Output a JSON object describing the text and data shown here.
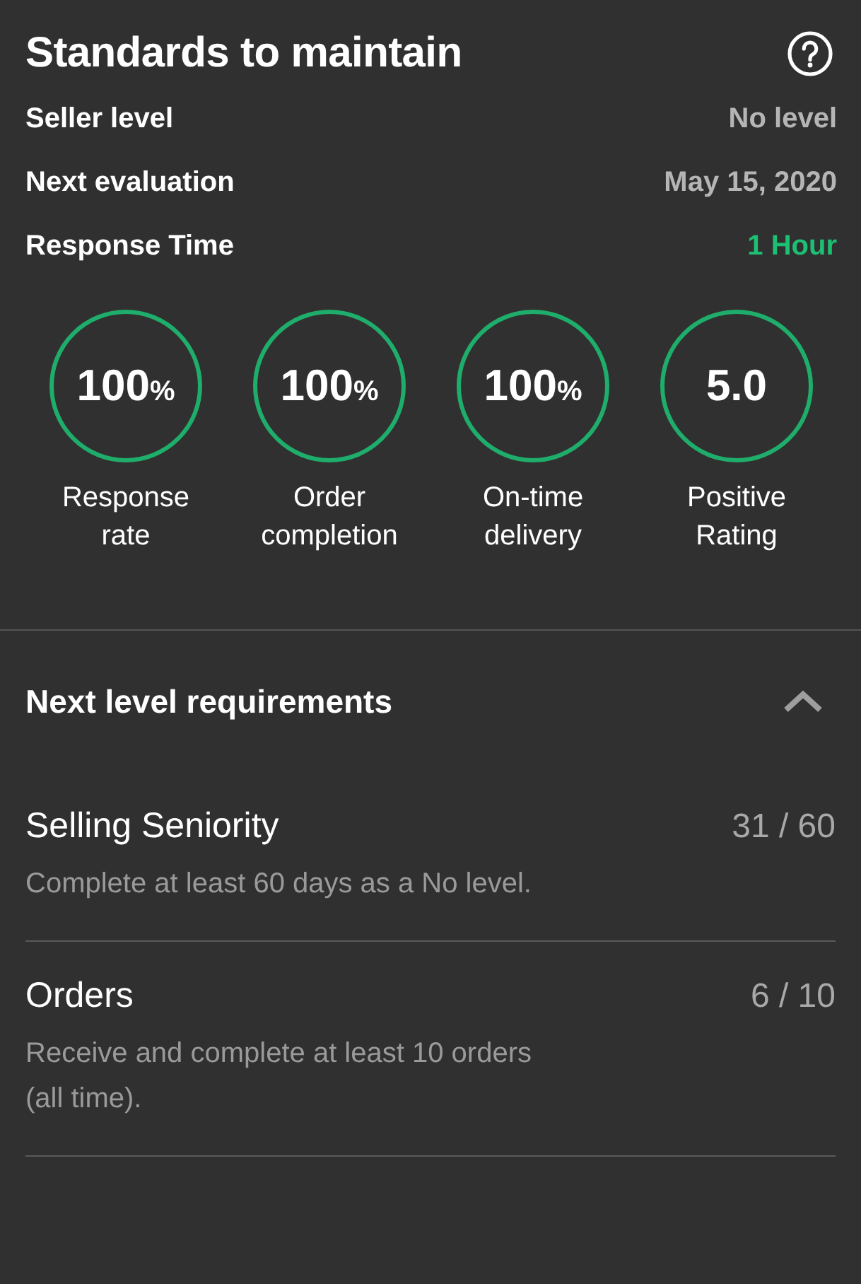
{
  "standards": {
    "title": "Standards to maintain",
    "rows": [
      {
        "label": "Seller level",
        "value": "No level",
        "highlighted": false
      },
      {
        "label": "Next evaluation",
        "value": "May 15, 2020",
        "highlighted": false
      },
      {
        "label": "Response Time",
        "value": "1 Hour",
        "highlighted": true
      }
    ],
    "metrics": [
      {
        "value": "100",
        "unit": "%",
        "label": "Response rate"
      },
      {
        "value": "100",
        "unit": "%",
        "label": "Order completion"
      },
      {
        "value": "100",
        "unit": "%",
        "label": "On-time delivery"
      },
      {
        "value": "5.0",
        "label": "Positive Rating"
      }
    ]
  },
  "requirements": {
    "title": "Next level requirements",
    "expanded": true,
    "items": [
      {
        "name": "Selling Seniority",
        "progress": "31 / 60",
        "description": "Complete at least 60 days as a No level."
      },
      {
        "name": "Orders",
        "progress": "6 / 10",
        "description": "Receive and complete at least 10 orders (all time)."
      }
    ]
  }
}
